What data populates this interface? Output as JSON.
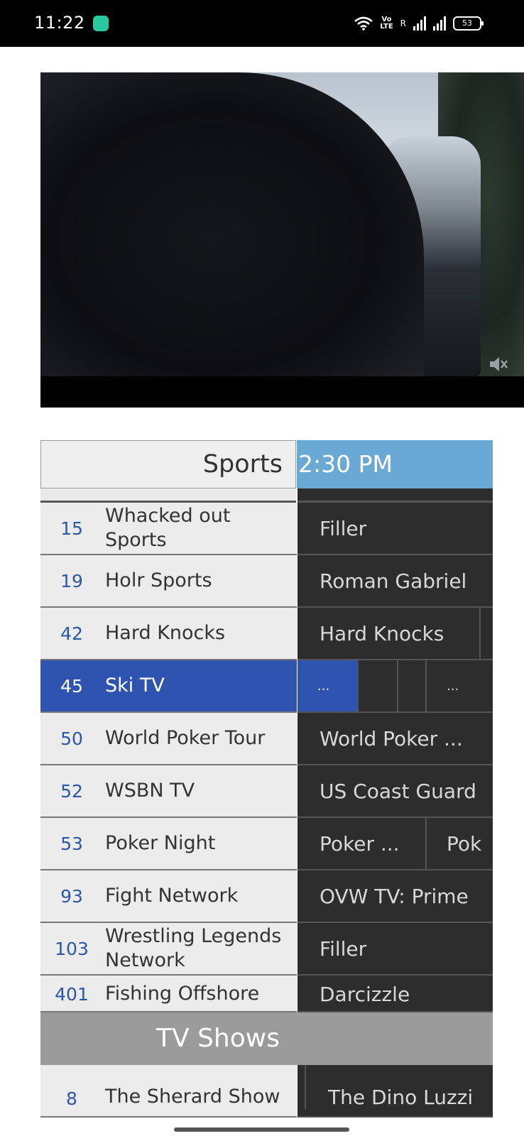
{
  "status_bar": {
    "time": "11:22",
    "carrier_tag_top": "Vo",
    "carrier_tag_bottom": "LTE",
    "roaming": "R",
    "battery": "53"
  },
  "guide": {
    "category": "Sports",
    "time_slot": "2:30 PM",
    "channels": [
      {
        "number": "15",
        "name": "Whacked out Sports",
        "programs": [
          "Filler"
        ]
      },
      {
        "number": "19",
        "name": "Holr Sports",
        "programs": [
          "Roman Gabriel"
        ]
      },
      {
        "number": "42",
        "name": "Hard Knocks",
        "programs": [
          "Hard Knocks"
        ]
      },
      {
        "number": "45",
        "name": "Ski TV",
        "programs": [
          "...",
          "",
          "",
          "..."
        ],
        "selected": true
      },
      {
        "number": "50",
        "name": "World Poker Tour",
        "programs": [
          "World Poker ..."
        ]
      },
      {
        "number": "52",
        "name": "WSBN TV",
        "programs": [
          "US Coast Guard"
        ]
      },
      {
        "number": "53",
        "name": "Poker Night",
        "programs": [
          "Poker ...",
          "Pok"
        ]
      },
      {
        "number": "93",
        "name": "Fight Network",
        "programs": [
          "OVW TV: Prime"
        ]
      },
      {
        "number": "103",
        "name": "Wrestling Legends Network",
        "programs": [
          "Filler"
        ]
      },
      {
        "number": "401",
        "name": "Fishing Offshore",
        "programs": [
          "Darcizzle"
        ]
      }
    ],
    "next_section": "TV Shows",
    "next_section_first": {
      "number": "8",
      "name": "The Sherard Show",
      "program": "The Dino Luzzi"
    }
  },
  "video": {
    "muted": true,
    "icon": "mute-icon"
  }
}
